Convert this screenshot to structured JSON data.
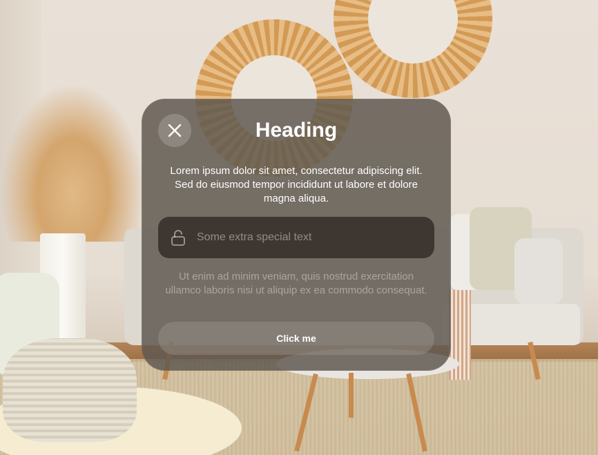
{
  "dialog": {
    "heading": "Heading",
    "body": "Lorem ipsum dolor sit amet, consectetur adipiscing elit. Sed do eiusmod tempor incididunt ut labore et dolore magna aliqua.",
    "field": {
      "icon": "lock-open-icon",
      "text": "Some extra special text"
    },
    "secondary": "Ut enim ad minim veniam, quis nostrud exercitation ullamco laboris nisi ut aliquip ex ea commodo consequat.",
    "button_label": "Click me",
    "close_icon": "close-icon"
  },
  "colors": {
    "card_background": "#5f5850",
    "field_background": "#37302a",
    "text": "#ffffff"
  },
  "background": {
    "description_type": "living-room-photo"
  }
}
